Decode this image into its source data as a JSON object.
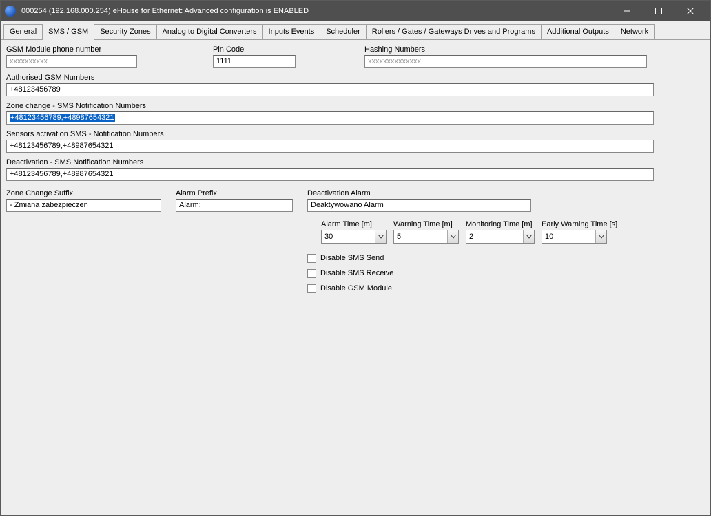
{
  "window": {
    "title": "000254 (192.168.000.254)    eHouse for Ethernet: Advanced configuration is ENABLED"
  },
  "tabs": [
    "General",
    "SMS / GSM",
    "Security Zones",
    "Analog to Digital Converters",
    "Inputs Events",
    "Scheduler",
    "Rollers / Gates / Gateways Drives  and Programs",
    "Additional Outputs",
    "Network"
  ],
  "labels": {
    "gsm_phone": "GSM Module phone number",
    "pin": "Pin Code",
    "hashing": "Hashing Numbers",
    "authorised": "Authorised GSM Numbers",
    "zone_change_notif": "Zone change - SMS Notification Numbers",
    "sensors_notif": "Sensors activation SMS - Notification Numbers",
    "deact_notif": "Deactivation - SMS Notification Numbers",
    "zone_suffix": "Zone Change Suffix",
    "alarm_prefix": "Alarm Prefix",
    "deact_alarm": "Deactivation Alarm",
    "alarm_time": "Alarm Time [m]",
    "warning_time": "Warning Time [m]",
    "monitoring_time": "Monitoring Time [m]",
    "early_warning": "Early Warning Time [s]",
    "disable_send": "Disable SMS Send",
    "disable_recv": "Disable SMS Receive",
    "disable_gsm": "Disable GSM Module"
  },
  "values": {
    "gsm_phone": "xxxxxxxxxx",
    "pin": "1111",
    "hashing": "xxxxxxxxxxxxxx",
    "authorised": "+48123456789",
    "zone_change_notif": "+48123456789,+48987654321",
    "sensors_notif": "+48123456789,+48987654321",
    "deact_notif": "+48123456789,+48987654321",
    "zone_suffix": " - Zmiana zabezpieczen",
    "alarm_prefix": "Alarm:",
    "deact_alarm": "Deaktywowano Alarm",
    "alarm_time": "30",
    "warning_time": "5",
    "monitoring_time": "2",
    "early_warning": "10"
  }
}
